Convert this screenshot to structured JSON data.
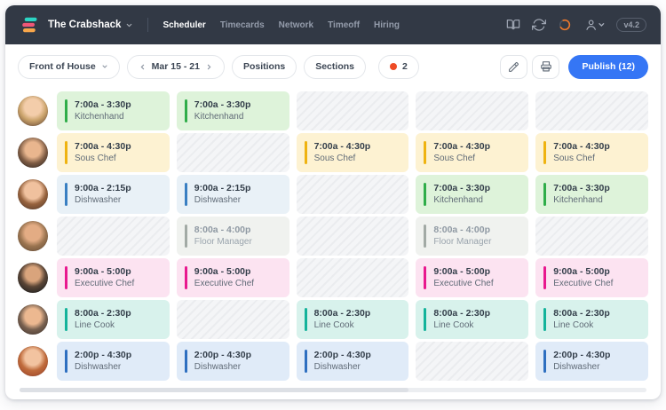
{
  "app": {
    "company": "The Crabshack",
    "version": "v4.2",
    "nav": [
      {
        "label": "Scheduler",
        "active": true
      },
      {
        "label": "Timecards",
        "active": false
      },
      {
        "label": "Network",
        "active": false
      },
      {
        "label": "Timeoff",
        "active": false
      },
      {
        "label": "Hiring",
        "active": false
      }
    ]
  },
  "toolbar": {
    "department": "Front of House",
    "date_range": "Mar 15 - 21",
    "positions": "Positions",
    "sections": "Sections",
    "alert_count": "2",
    "publish": "Publish (12)"
  },
  "icons": {
    "topbar_right": [
      "book-open-icon",
      "sync-icon",
      "progress-ring-icon",
      "user-menu-icon"
    ],
    "toolbar_right": [
      "edit-icon",
      "print-icon"
    ],
    "chevrons": [
      "chevron-down-icon",
      "chevron-left-icon",
      "chevron-right-icon"
    ]
  },
  "colors": {
    "topbar_bg": "#323945",
    "accent_blue": "#3576f5",
    "alert_dot": "#ee4b26",
    "shift": {
      "green": {
        "bg": "#def3da",
        "bar": "#2fad49",
        "muted": false
      },
      "yellow": {
        "bg": "#fdf2d2",
        "bar": "#efb310",
        "muted": false
      },
      "blue": {
        "bg": "#e9f1f7",
        "bar": "#3a7fc2",
        "muted": false
      },
      "gray": {
        "bg": "#f0f2ef",
        "bar": "#a2aaa5",
        "muted": true
      },
      "pink": {
        "bg": "#fce3f1",
        "bar": "#e8188e",
        "muted": false
      },
      "teal": {
        "bg": "#d8f2ec",
        "bar": "#14b39b",
        "muted": false
      },
      "blue2": {
        "bg": "#e0ebf8",
        "bar": "#2e6fc0",
        "muted": false
      }
    }
  },
  "schedule": {
    "rows": [
      {
        "shifts": [
          {
            "time": "7:00a - 3:30p",
            "role": "Kitchenhand",
            "color": "green"
          },
          {
            "time": "7:00a - 3:30p",
            "role": "Kitchenhand",
            "color": "green"
          },
          null,
          null,
          null
        ]
      },
      {
        "shifts": [
          {
            "time": "7:00a - 4:30p",
            "role": "Sous Chef",
            "color": "yellow"
          },
          null,
          {
            "time": "7:00a - 4:30p",
            "role": "Sous Chef",
            "color": "yellow"
          },
          {
            "time": "7:00a - 4:30p",
            "role": "Sous Chef",
            "color": "yellow"
          },
          {
            "time": "7:00a - 4:30p",
            "role": "Sous Chef",
            "color": "yellow"
          }
        ]
      },
      {
        "shifts": [
          {
            "time": "9:00a - 2:15p",
            "role": "Dishwasher",
            "color": "blue"
          },
          {
            "time": "9:00a - 2:15p",
            "role": "Dishwasher",
            "color": "blue"
          },
          null,
          {
            "time": "7:00a - 3:30p",
            "role": "Kitchenhand",
            "color": "green"
          },
          {
            "time": "7:00a - 3:30p",
            "role": "Kitchenhand",
            "color": "green"
          }
        ]
      },
      {
        "shifts": [
          null,
          {
            "time": "8:00a - 4:00p",
            "role": "Floor Manager",
            "color": "gray"
          },
          null,
          {
            "time": "8:00a - 4:00p",
            "role": "Floor Manager",
            "color": "gray"
          },
          null
        ]
      },
      {
        "shifts": [
          {
            "time": "9:00a - 5:00p",
            "role": "Executive Chef",
            "color": "pink"
          },
          {
            "time": "9:00a - 5:00p",
            "role": "Executive Chef",
            "color": "pink"
          },
          null,
          {
            "time": "9:00a - 5:00p",
            "role": "Executive Chef",
            "color": "pink"
          },
          {
            "time": "9:00a - 5:00p",
            "role": "Executive Chef",
            "color": "pink"
          }
        ]
      },
      {
        "shifts": [
          {
            "time": "8:00a - 2:30p",
            "role": "Line Cook",
            "color": "teal"
          },
          null,
          {
            "time": "8:00a - 2:30p",
            "role": "Line Cook",
            "color": "teal"
          },
          {
            "time": "8:00a - 2:30p",
            "role": "Line Cook",
            "color": "teal"
          },
          {
            "time": "8:00a - 2:30p",
            "role": "Line Cook",
            "color": "teal"
          }
        ]
      },
      {
        "shifts": [
          {
            "time": "2:00p - 4:30p",
            "role": "Dishwasher",
            "color": "blue2"
          },
          {
            "time": "2:00p - 4:30p",
            "role": "Dishwasher",
            "color": "blue2"
          },
          {
            "time": "2:00p - 4:30p",
            "role": "Dishwasher",
            "color": "blue2"
          },
          null,
          {
            "time": "2:00p - 4:30p",
            "role": "Dishwasher",
            "color": "blue2"
          }
        ]
      }
    ]
  }
}
